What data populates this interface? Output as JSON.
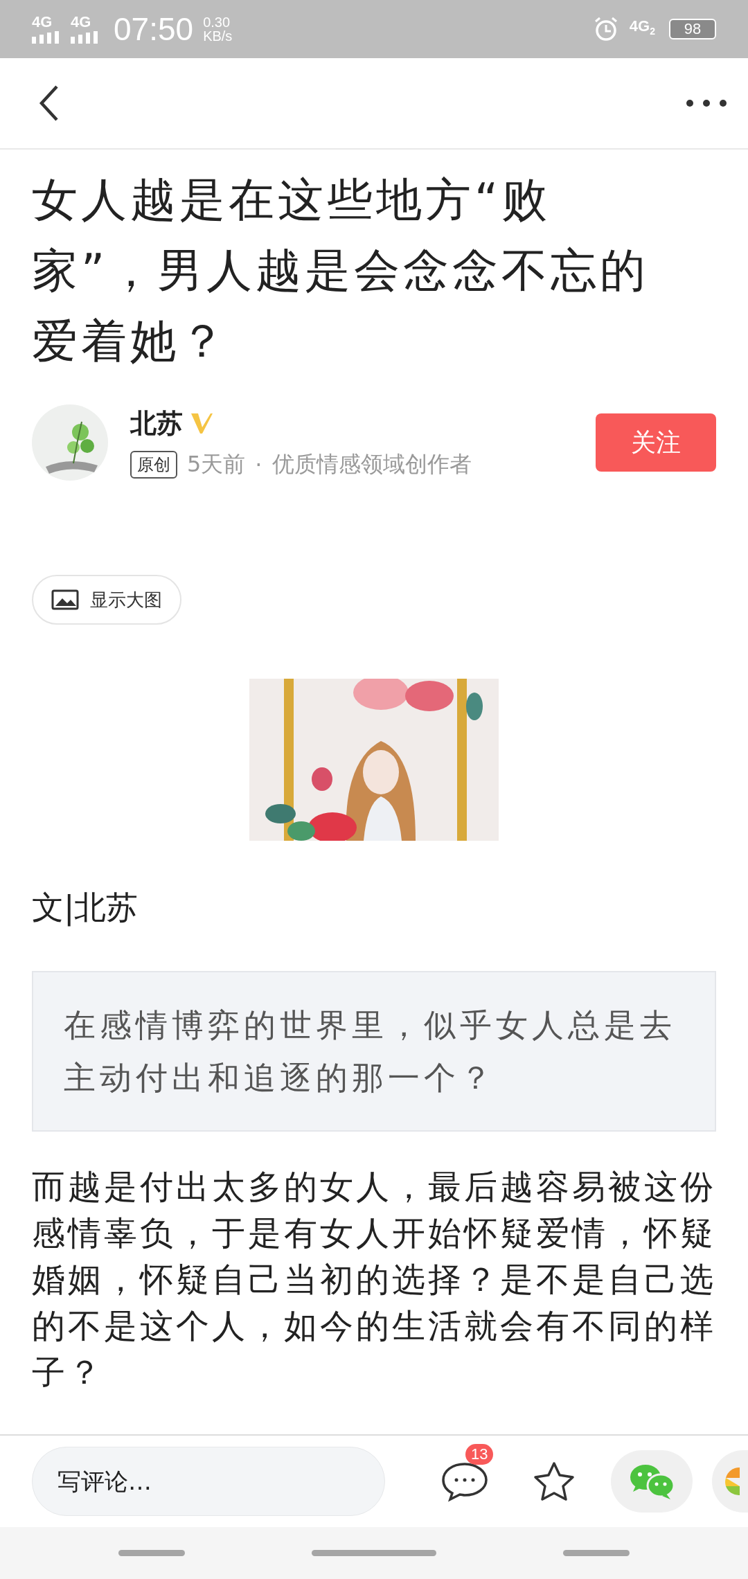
{
  "status_bar": {
    "network_1": "4G",
    "network_2": "4G",
    "time": "07:50",
    "speed_value": "0.30",
    "speed_unit": "KB/s",
    "network_3": "4G",
    "sim": "2",
    "battery": "98"
  },
  "article": {
    "title": "女人越是在这些地方“败家”，男人越是会念念不忘的爱着她？",
    "author": {
      "name": "北苏",
      "verified": true,
      "original_tag": "原创",
      "time": "5天前",
      "separator": "·",
      "description": "优质情感领域创作者",
      "follow_label": "关注"
    },
    "show_image_label": "显示大图",
    "byline": "文|北苏",
    "quote": "在感情博弈的世界里，似乎女人总是去主动付出和追逐的那一个？",
    "paragraph": "而越是付出太多的女人，最后越容易被这份感情辜负，于是有女人开始怀疑爱情，怀疑婚姻，怀疑自己当初的选择？是不是自己选的不是这个人，如今的生活就会有不同的样子？"
  },
  "bottom_bar": {
    "comment_placeholder": "写评论…",
    "comment_count": "13"
  }
}
